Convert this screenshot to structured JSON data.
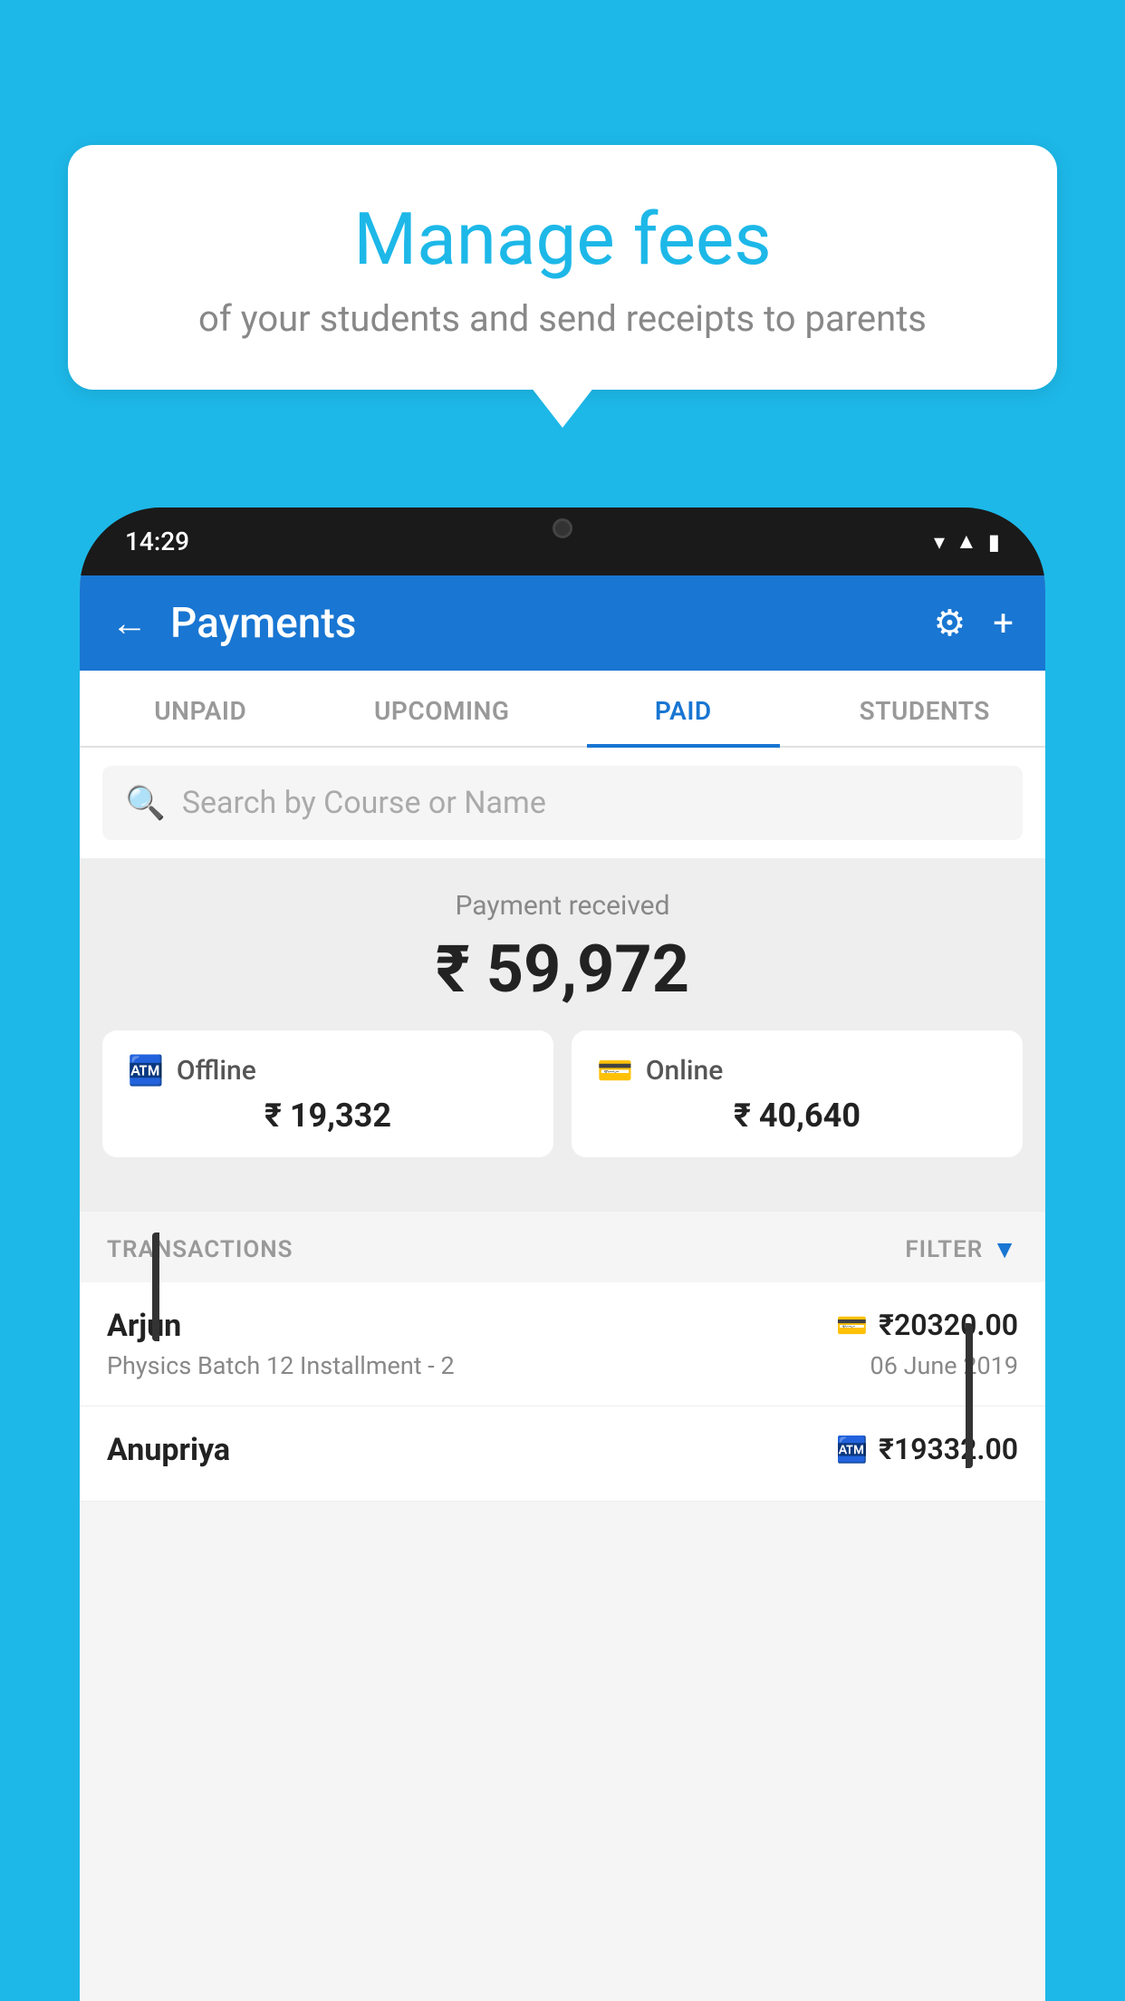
{
  "page": {
    "background_color": "#1db8e8"
  },
  "bubble": {
    "title": "Manage fees",
    "subtitle": "of your students and send receipts to parents"
  },
  "phone": {
    "status_time": "14:29",
    "header": {
      "title": "Payments",
      "back_icon": "←",
      "settings_icon": "⚙",
      "add_icon": "+"
    },
    "tabs": [
      {
        "id": "unpaid",
        "label": "UNPAID",
        "active": false
      },
      {
        "id": "upcoming",
        "label": "UPCOMING",
        "active": false
      },
      {
        "id": "paid",
        "label": "PAID",
        "active": true
      },
      {
        "id": "students",
        "label": "STUDENTS",
        "active": false
      }
    ],
    "search": {
      "placeholder": "Search by Course or Name"
    },
    "payment_summary": {
      "label": "Payment received",
      "total": "₹ 59,972",
      "offline_label": "Offline",
      "offline_amount": "₹ 19,332",
      "online_label": "Online",
      "online_amount": "₹ 40,640"
    },
    "transactions": {
      "section_label": "TRANSACTIONS",
      "filter_label": "FILTER",
      "items": [
        {
          "name": "Arjun",
          "course": "Physics Batch 12 Installment - 2",
          "date": "06 June 2019",
          "amount": "₹20320.00",
          "payment_type": "online"
        },
        {
          "name": "Anupriya",
          "course": "",
          "date": "",
          "amount": "₹19332.00",
          "payment_type": "offline"
        }
      ]
    }
  }
}
